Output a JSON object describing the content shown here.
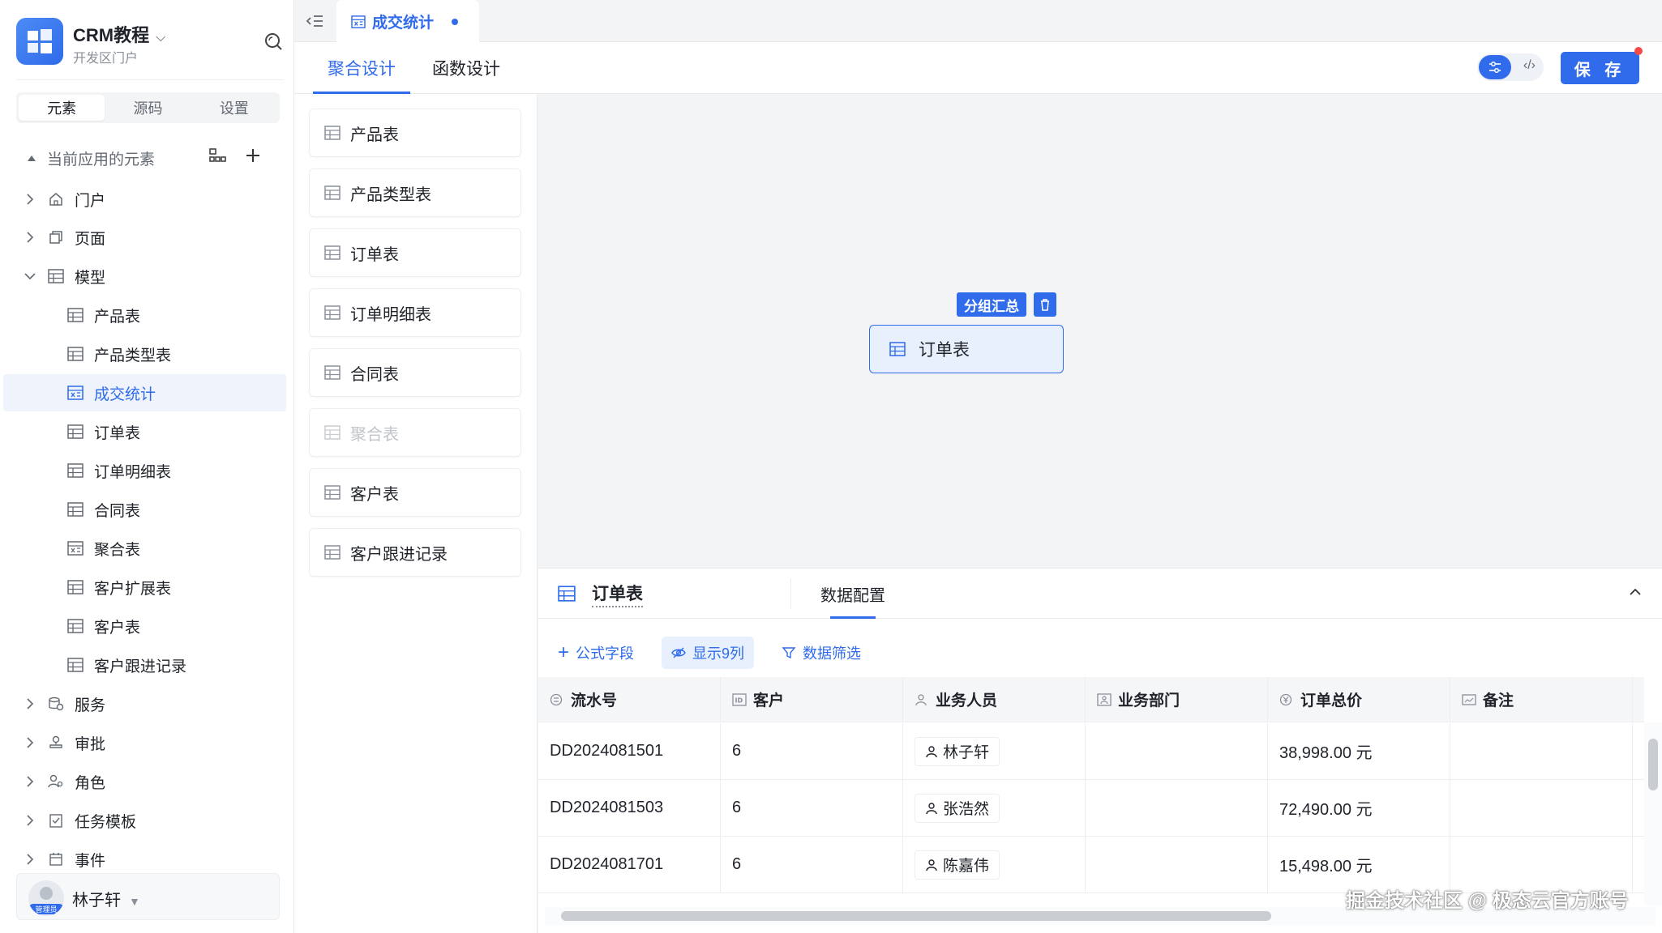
{
  "app": {
    "name": "CRM教程",
    "subtitle": "开发区门户"
  },
  "sidebar": {
    "segments": [
      {
        "label": "元素",
        "active": true
      },
      {
        "label": "源码",
        "active": false
      },
      {
        "label": "设置",
        "active": false
      }
    ],
    "section_title": "当前应用的元素",
    "top_items": [
      {
        "label": "门户",
        "icon": "home-icon"
      },
      {
        "label": "页面",
        "icon": "pages-icon"
      }
    ],
    "model_group": {
      "label": "模型",
      "icon": "table-icon"
    },
    "model_items": [
      {
        "label": "产品表",
        "icon": "table-icon",
        "selected": false
      },
      {
        "label": "产品类型表",
        "icon": "table-icon",
        "selected": false
      },
      {
        "label": "成交统计",
        "icon": "aggregate-table-icon",
        "selected": true
      },
      {
        "label": "订单表",
        "icon": "table-icon",
        "selected": false
      },
      {
        "label": "订单明细表",
        "icon": "table-icon",
        "selected": false
      },
      {
        "label": "合同表",
        "icon": "table-icon",
        "selected": false
      },
      {
        "label": "聚合表",
        "icon": "aggregate-table-icon",
        "selected": false
      },
      {
        "label": "客户扩展表",
        "icon": "table-icon",
        "selected": false
      },
      {
        "label": "客户表",
        "icon": "table-icon",
        "selected": false
      },
      {
        "label": "客户跟进记录",
        "icon": "table-icon",
        "selected": false
      }
    ],
    "bottom_items": [
      {
        "label": "服务",
        "icon": "service-icon"
      },
      {
        "label": "审批",
        "icon": "approval-icon"
      },
      {
        "label": "角色",
        "icon": "role-icon"
      },
      {
        "label": "任务模板",
        "icon": "task-icon"
      },
      {
        "label": "事件",
        "icon": "event-icon"
      }
    ],
    "user": {
      "name": "林子轩",
      "badge": "管理员"
    }
  },
  "topbar": {
    "tab_label": "成交统计"
  },
  "design_tabs": [
    {
      "label": "聚合设计",
      "active": true
    },
    {
      "label": "函数设计",
      "active": false
    }
  ],
  "save_label": "保 存",
  "model_list": [
    {
      "label": "产品表",
      "disabled": false
    },
    {
      "label": "产品类型表",
      "disabled": false
    },
    {
      "label": "订单表",
      "disabled": false
    },
    {
      "label": "订单明细表",
      "disabled": false
    },
    {
      "label": "合同表",
      "disabled": false
    },
    {
      "label": "聚合表",
      "disabled": true
    },
    {
      "label": "客户表",
      "disabled": false
    },
    {
      "label": "客户跟进记录",
      "disabled": false
    }
  ],
  "canvas": {
    "node_tag": "分组汇总",
    "node_label": "订单表"
  },
  "panel": {
    "title": "订单表",
    "tab": "数据配置",
    "toolbar": {
      "formula_field": "公式字段",
      "show_columns": "显示9列",
      "data_filter": "数据筛选"
    },
    "columns": [
      {
        "label": "流水号",
        "icon": "serial-icon"
      },
      {
        "label": "客户",
        "icon": "id-icon"
      },
      {
        "label": "业务人员",
        "icon": "person-icon"
      },
      {
        "label": "业务部门",
        "icon": "department-icon"
      },
      {
        "label": "订单总价",
        "icon": "currency-icon"
      },
      {
        "label": "备注",
        "icon": "note-icon"
      }
    ],
    "rows": [
      {
        "serial": "DD2024081501",
        "customer": "6",
        "person": "林子轩",
        "dept": "",
        "total": "38,998.00 元",
        "note": ""
      },
      {
        "serial": "DD2024081503",
        "customer": "6",
        "person": "张浩然",
        "dept": "",
        "total": "72,490.00 元",
        "note": ""
      },
      {
        "serial": "DD2024081701",
        "customer": "6",
        "person": "陈嘉伟",
        "dept": "",
        "total": "15,498.00 元",
        "note": ""
      }
    ]
  },
  "watermark": "掘金技术社区 @ 极态云官方账号",
  "colors": {
    "primary": "#2f6bea",
    "selected_bg": "#eef3fc",
    "canvas_bg": "#f3f4f6"
  }
}
